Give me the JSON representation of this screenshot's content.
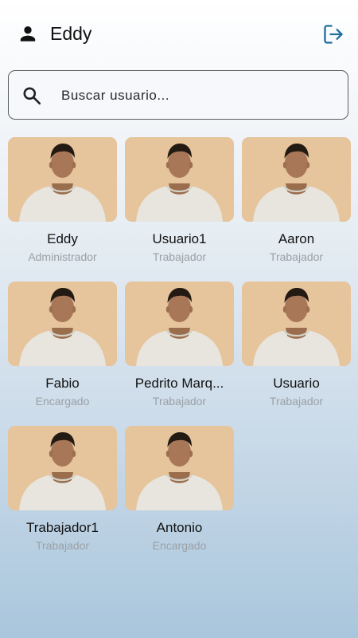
{
  "header": {
    "user_name": "Eddy",
    "user_icon": "person-icon",
    "logout_icon": "logout-icon"
  },
  "search": {
    "placeholder": "Buscar usuario...",
    "value": "",
    "icon": "search-icon"
  },
  "users": [
    {
      "name": "Eddy",
      "role": "Administrador"
    },
    {
      "name": "Usuario1",
      "role": "Trabajador"
    },
    {
      "name": "Aaron",
      "role": "Trabajador"
    },
    {
      "name": "Fabio",
      "role": "Encargado"
    },
    {
      "name": "Pedrito Marq...",
      "role": "Trabajador"
    },
    {
      "name": "Usuario",
      "role": "Trabajador"
    },
    {
      "name": "Trabajador1",
      "role": "Trabajador"
    },
    {
      "name": "Antonio",
      "role": "Encargado"
    }
  ],
  "colors": {
    "accent": "#1f6f9f",
    "role_text": "#9aa0a6",
    "photo_background": "#e6c49c"
  }
}
